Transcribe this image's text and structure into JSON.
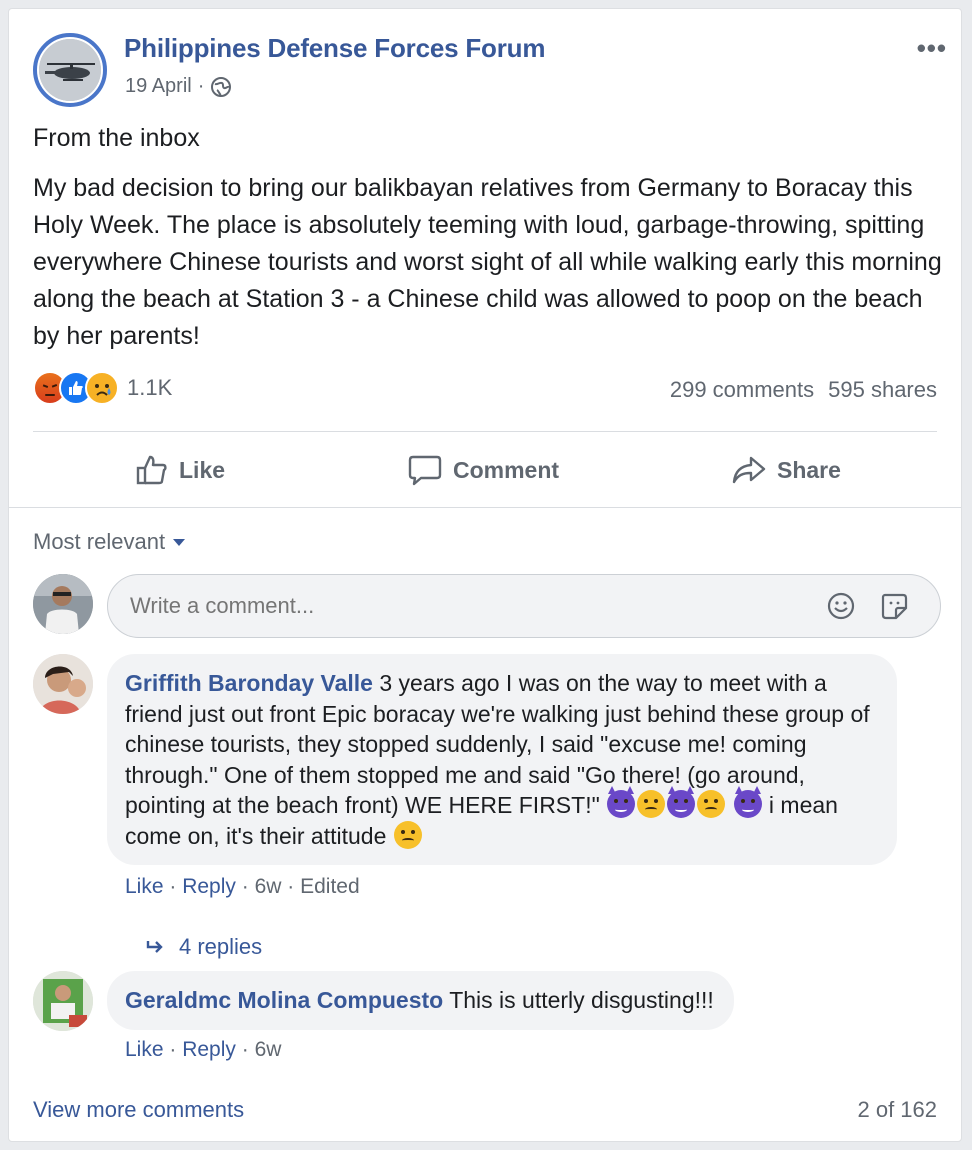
{
  "post": {
    "page_name": "Philippines Defense Forces Forum",
    "date": "19 April",
    "meta_sep": "·",
    "title": "From the inbox",
    "text": "My bad decision to bring our balikbayan relatives from Germany to Boracay this Holy Week. The place is absolutely teeming with loud, garbage-throwing, spitting everywhere Chinese tourists and worst sight of all while walking early this morning along the beach at Station 3 - a Chinese child was allowed to poop on the beach by her parents!",
    "reaction_count": "1.1K",
    "reactions": [
      "angry-icon",
      "like-icon",
      "sad-icon"
    ],
    "comments_count": "299 comments",
    "shares_count": "595 shares",
    "more": "•••"
  },
  "actions": {
    "like": "Like",
    "comment": "Comment",
    "share": "Share"
  },
  "sort": {
    "label": "Most relevant"
  },
  "composer": {
    "placeholder": "Write a comment..."
  },
  "comments": [
    {
      "author": "Griffith Baronday Valle",
      "text_1": " 3 years ago I was on the way to meet with a friend just out front Epic boracay we're walking just behind these group of chinese tourists, they stopped suddenly, I said \"excuse me! coming through.\" One of them stopped me and said \"Go there! (go around, pointing at the beach front) WE HERE FIRST!\" ",
      "text_2": " i mean come on, it's their attitude ",
      "like": "Like",
      "reply": "Reply",
      "time": "6w",
      "edited": "Edited",
      "replies": "4 replies"
    },
    {
      "author": "Geraldmc Molina Compuesto",
      "text_1": " This is utterly disgusting!!!",
      "like": "Like",
      "reply": "Reply",
      "time": "6w"
    }
  ],
  "footer": {
    "view_more": "View more comments",
    "count": "2 of 162"
  },
  "colors": {
    "link": "#385898",
    "secondary": "#606770",
    "bubble": "#f2f3f5"
  }
}
